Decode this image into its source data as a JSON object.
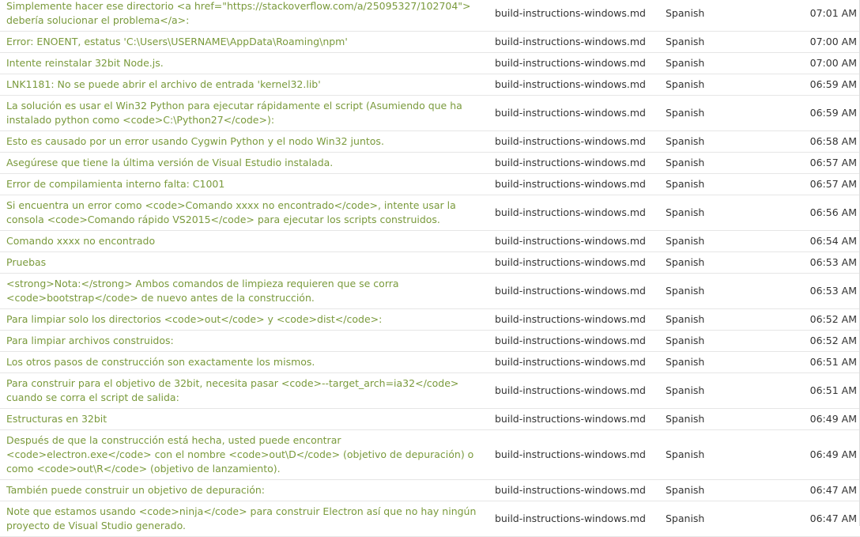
{
  "rows": [
    {
      "text": "Simplemente hacer ese directorio <a href=\"https://stackoverflow.com/a/25095327/102704\"> debería solucionar el problema</a>:",
      "file": "build-instructions-windows.md",
      "language": "Spanish",
      "time": "07:01 AM"
    },
    {
      "text": "Error: ENOENT, estatus 'C:\\Users\\USERNAME\\AppData\\Roaming\\npm'",
      "file": "build-instructions-windows.md",
      "language": "Spanish",
      "time": "07:00 AM"
    },
    {
      "text": "Intente reinstalar 32bit Node.js.",
      "file": "build-instructions-windows.md",
      "language": "Spanish",
      "time": "07:00 AM"
    },
    {
      "text": "LNK1181: No se puede abrir el archivo de entrada 'kernel32.lib'",
      "file": "build-instructions-windows.md",
      "language": "Spanish",
      "time": "06:59 AM"
    },
    {
      "text": "La solución es usar el Win32 Python para ejecutar rápidamente el script (Asumiendo que ha instalado python como <code>C:\\Python27</code>):",
      "file": "build-instructions-windows.md",
      "language": "Spanish",
      "time": "06:59 AM"
    },
    {
      "text": "Esto es causado por un error usando Cygwin Python y el nodo Win32 juntos.",
      "file": "build-instructions-windows.md",
      "language": "Spanish",
      "time": "06:58 AM"
    },
    {
      "text": "Asegúrese que tiene la última versión de Visual Estudio instalada.",
      "file": "build-instructions-windows.md",
      "language": "Spanish",
      "time": "06:57 AM"
    },
    {
      "text": "Error de compilamienta interno falta: C1001",
      "file": "build-instructions-windows.md",
      "language": "Spanish",
      "time": "06:57 AM"
    },
    {
      "text": "Si encuentra un error como <code>Comando xxxx no encontrado</code>, intente usar la consola <code>Comando rápido VS2015</code> para ejecutar los scripts construidos.",
      "file": "build-instructions-windows.md",
      "language": "Spanish",
      "time": "06:56 AM"
    },
    {
      "text": "Comando xxxx no encontrado",
      "file": "build-instructions-windows.md",
      "language": "Spanish",
      "time": "06:54 AM"
    },
    {
      "text": "Pruebas",
      "file": "build-instructions-windows.md",
      "language": "Spanish",
      "time": "06:53 AM"
    },
    {
      "text": "<strong>Nota:</strong> Ambos comandos de limpieza requieren que se corra <code>bootstrap</code> de nuevo antes de la construcción.",
      "file": "build-instructions-windows.md",
      "language": "Spanish",
      "time": "06:53 AM"
    },
    {
      "text": "Para limpiar solo los directorios <code>out</code> y <code>dist</code>:",
      "file": "build-instructions-windows.md",
      "language": "Spanish",
      "time": "06:52 AM"
    },
    {
      "text": "Para limpiar archivos construidos:",
      "file": "build-instructions-windows.md",
      "language": "Spanish",
      "time": "06:52 AM"
    },
    {
      "text": "Los otros pasos de construcción son exactamente los mismos.",
      "file": "build-instructions-windows.md",
      "language": "Spanish",
      "time": "06:51 AM"
    },
    {
      "text": "Para construir para el objetivo de 32bit, necesita pasar <code>--target_arch=ia32</code> cuando se corra el script de salida:",
      "file": "build-instructions-windows.md",
      "language": "Spanish",
      "time": "06:51 AM"
    },
    {
      "text": "Estructuras en 32bit",
      "file": "build-instructions-windows.md",
      "language": "Spanish",
      "time": "06:49 AM"
    },
    {
      "text": "Después de que la construcción está hecha, usted puede encontrar <code>electron.exe</code> con el nombre <code>out\\D</code> (objetivo de depuración) o como <code>out\\R</code> (objetivo de lanzamiento).",
      "file": "build-instructions-windows.md",
      "language": "Spanish",
      "time": "06:49 AM"
    },
    {
      "text": "También puede construir un objetivo de depuración:",
      "file": "build-instructions-windows.md",
      "language": "Spanish",
      "time": "06:47 AM"
    },
    {
      "text": "Note que estamos usando <code>ninja</code> para construir Electron así que no hay ningún proyecto de Visual Studio generado.",
      "file": "build-instructions-windows.md",
      "language": "Spanish",
      "time": "06:47 AM"
    }
  ]
}
